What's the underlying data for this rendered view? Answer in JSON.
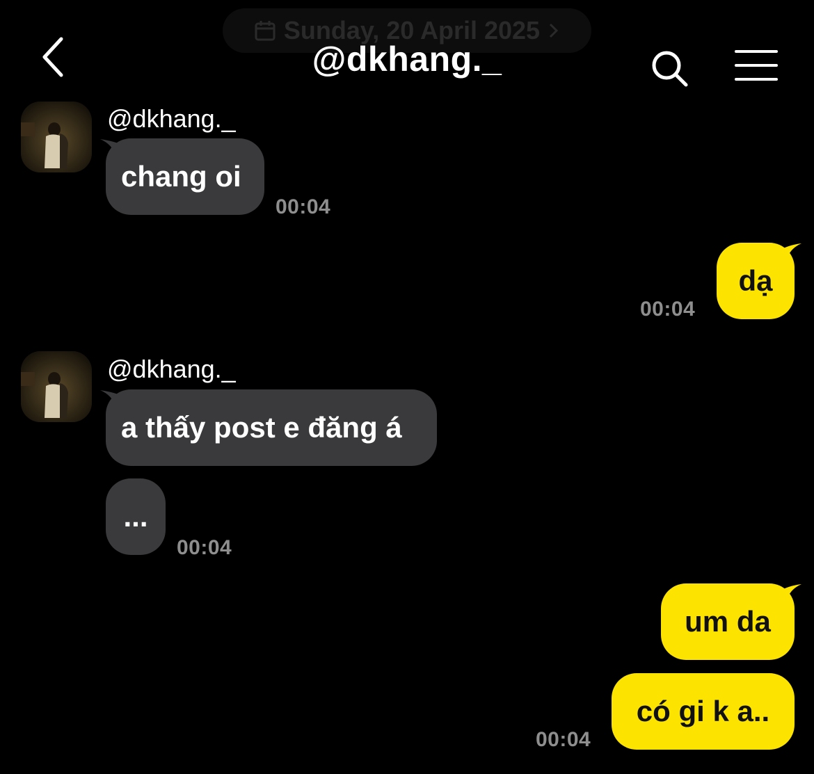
{
  "header": {
    "date": "Sunday, 20 April 2025",
    "title": "@dkhang._"
  },
  "messages": [
    {
      "sender": "@dkhang._",
      "text": "chang oi",
      "time": "00:04"
    },
    {
      "text": "dạ",
      "time": "00:04"
    },
    {
      "sender": "@dkhang._",
      "text": "a thấy post e đăng á"
    },
    {
      "text": "...",
      "time": "00:04"
    },
    {
      "text": "um da"
    },
    {
      "text": "có gi k a..",
      "time": "00:04"
    }
  ],
  "colors": {
    "background": "#000000",
    "incoming_bubble": "#3a3a3c",
    "outgoing_bubble": "#fce300",
    "timestamp": "#8e8e8e"
  },
  "icons": [
    "calendar-icon",
    "chevron-right-icon",
    "back-arrow-icon",
    "search-icon",
    "menu-icon"
  ]
}
